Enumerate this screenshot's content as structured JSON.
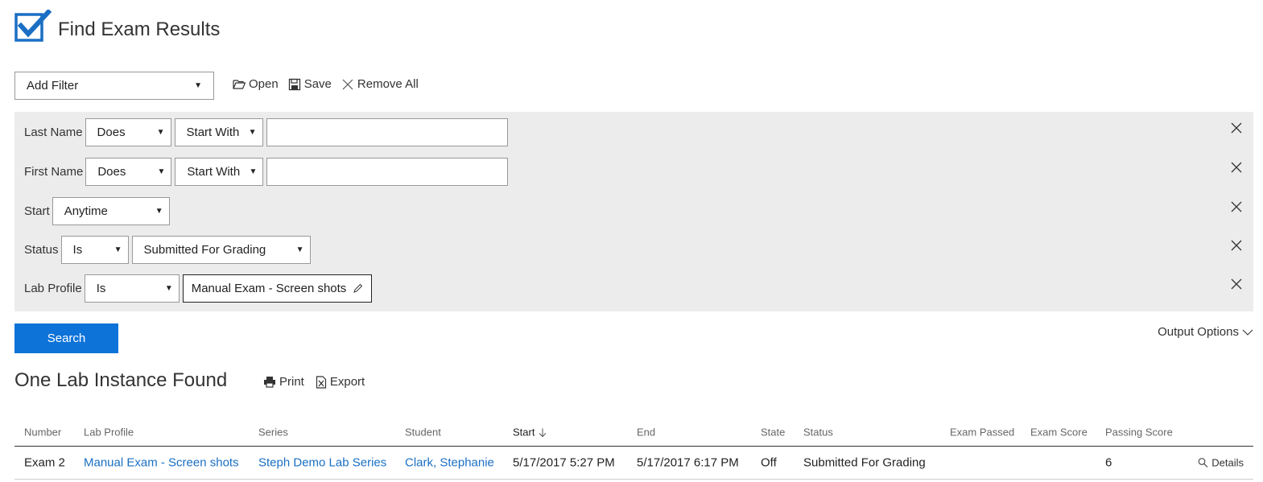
{
  "header": {
    "title": "Find Exam Results"
  },
  "toolbar": {
    "add_filter_value": "Add Filter",
    "open_label": "Open",
    "save_label": "Save",
    "remove_all_label": "Remove All"
  },
  "filters": {
    "last_name": {
      "label": "Last Name",
      "operator": "Does",
      "condition": "Start With",
      "value": ""
    },
    "first_name": {
      "label": "First Name",
      "operator": "Does",
      "condition": "Start With",
      "value": ""
    },
    "start": {
      "label": "Start",
      "value": "Anytime"
    },
    "status": {
      "label": "Status",
      "operator": "Is",
      "value": "Submitted For Grading"
    },
    "lab_profile": {
      "label": "Lab Profile",
      "operator": "Is",
      "value": "Manual Exam - Screen shots"
    }
  },
  "search": {
    "label": "Search"
  },
  "output_options": {
    "label": "Output Options"
  },
  "results": {
    "title": "One Lab Instance Found",
    "print_label": "Print",
    "export_label": "Export",
    "columns": [
      "Number",
      "Lab Profile",
      "Series",
      "Student",
      "Start",
      "End",
      "State",
      "Status",
      "Exam Passed",
      "Exam Score",
      "Passing Score"
    ],
    "rows": [
      {
        "number": "Exam 2",
        "lab_profile": "Manual Exam - Screen shots",
        "series": "Steph Demo Lab Series",
        "student": "Clark, Stephanie",
        "start": "5/17/2017 5:27 PM",
        "end": "5/17/2017 6:17 PM",
        "state": "Off",
        "status": "Submitted For Grading",
        "exam_passed": "",
        "exam_score": "",
        "passing_score": "6",
        "details_label": "Details"
      }
    ]
  },
  "colors": {
    "accent": "#0e73d8",
    "link": "#1a6fc4",
    "panel": "#ececec"
  }
}
